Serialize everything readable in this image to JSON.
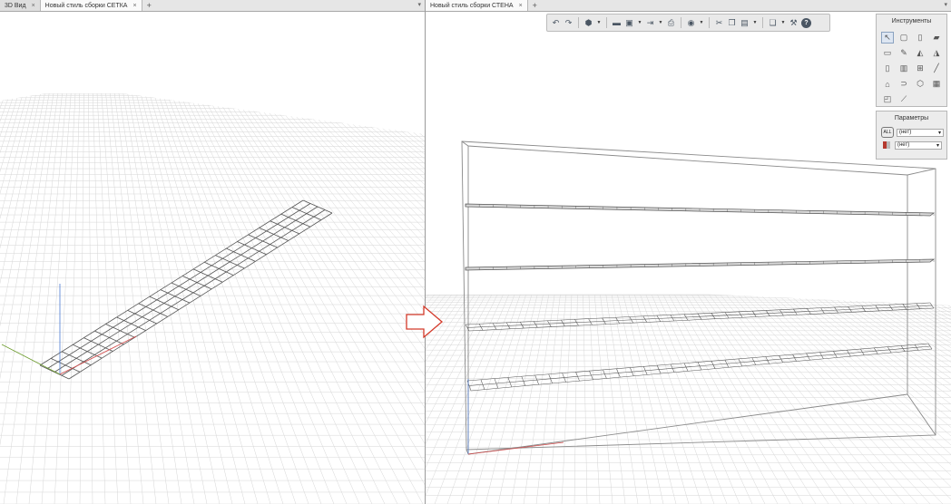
{
  "left_pane": {
    "tabs": [
      {
        "label": "3D Вид",
        "active": false
      },
      {
        "label": "Новый стиль сборки СЕТКА",
        "active": true
      }
    ],
    "add_tab": "+",
    "close_glyph": "×",
    "pane_menu": "▾"
  },
  "right_pane": {
    "tabs": [
      {
        "label": "Новый стиль сборки СТЕНА",
        "active": true
      }
    ],
    "add_tab": "+",
    "close_glyph": "×",
    "pane_menu": "▾"
  },
  "toolbar": {
    "icons": [
      "undo-icon",
      "redo-icon",
      "cube-icon",
      "folder-icon",
      "save-icon",
      "export-icon",
      "print-icon",
      "render-icon",
      "cut-icon",
      "copy-icon",
      "paste-icon",
      "layers-icon",
      "wrench-icon",
      "help-icon"
    ]
  },
  "tools_panel": {
    "title": "Инструменты",
    "tools": [
      "select-icon",
      "wall-icon",
      "column-icon",
      "slab-icon",
      "beam-icon",
      "pencil-icon",
      "roof-icon",
      "stair-icon",
      "door-icon",
      "window-icon",
      "railing-icon",
      "line-icon",
      "curtain-wall-icon",
      "pipe-icon",
      "object-icon",
      "morph-icon",
      "zone-icon",
      "measure-icon"
    ]
  },
  "params_panel": {
    "title": "Параметры",
    "rows": [
      {
        "icon": "layer-param-icon",
        "icon_text": "ALL",
        "value": "(нет)"
      },
      {
        "icon": "material-param-icon",
        "icon_text": "",
        "value": "(нет)"
      }
    ]
  },
  "colors": {
    "grid": "#d6d6d6",
    "grid_major": "#c9c9c9",
    "mesh": "#555555",
    "box": "#8a8a8a",
    "axis_x": "#d24b4b",
    "axis_y": "#6a9a2a",
    "axis_z": "#4b7bd2",
    "arrow": "#d43a2a",
    "accent": "#4a5663"
  }
}
